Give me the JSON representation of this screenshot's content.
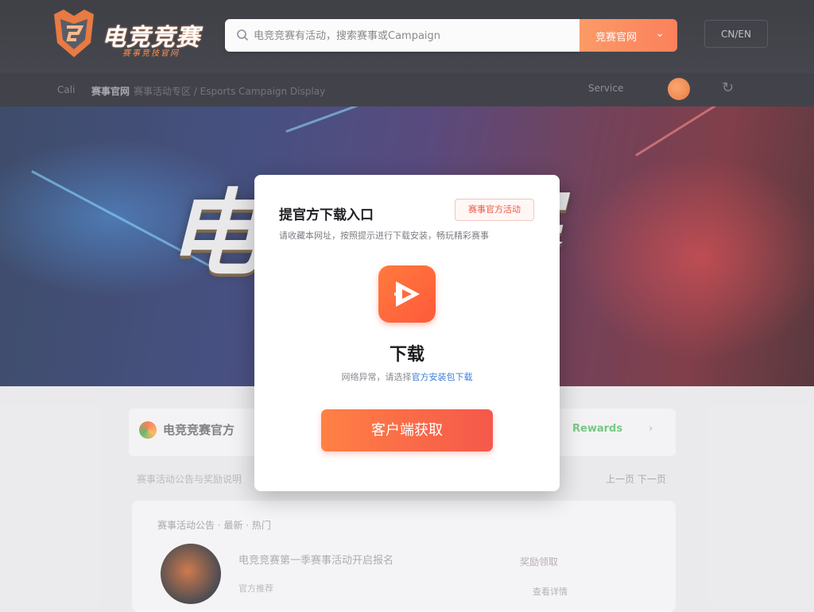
{
  "header": {
    "logo_title": "电竞竞赛",
    "logo_subtitle": "赛事竞技官网",
    "search": {
      "placeholder": "电竞竞赛有活动，搜索赛事或Campaign",
      "button_label": "竞赛官网",
      "icon": "search-icon"
    },
    "language_label": "CN/EN"
  },
  "nav": {
    "home": "Cali",
    "current": "赛事官网",
    "trail": "赛事活动专区 / Esports Campaign Display",
    "menu_label": "Service",
    "refresh_icon": "refresh-icon"
  },
  "banner": {
    "title": "电竞竞赛"
  },
  "lower": {
    "title": "电竞竞赛官方",
    "badge": "Rewards",
    "subtitle": "赛事活动公告与奖励说明",
    "pager": "上一页  下一页",
    "list_header": "赛事活动公告 · 最新 · 热门",
    "item_title": "电竞竞赛第一季赛事活动开启报名",
    "item_tag": "官方推荐",
    "item_price": "奖励领取",
    "item_meta": "查看详情"
  },
  "modal": {
    "title": "提官方下载入口",
    "badge": "赛事官方活动",
    "description": "请收藏本网址，按照提示进行下载安装，畅玩精彩赛事",
    "download_title": "下载",
    "download_sub_prefix": "网络异常，请选择",
    "download_sub_link": "官方安装包下载",
    "cta_label": "客户端获取"
  },
  "colors": {
    "accent": "#ff6a3c",
    "header_bg": "#1b1c22",
    "link": "#3b7dd8",
    "badge_border": "#f3c6bc"
  }
}
